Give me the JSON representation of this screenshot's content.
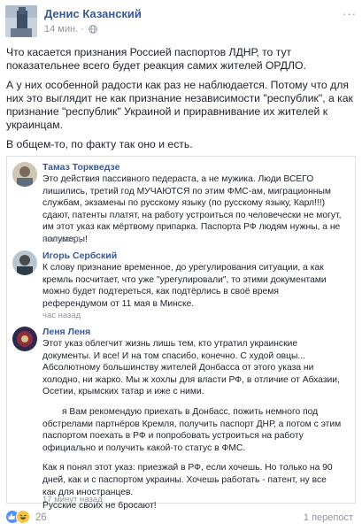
{
  "post": {
    "author": "Денис Казанский",
    "time": "14 мин.",
    "more_label": "···",
    "globe_icon": "globe-icon",
    "paragraphs": [
      "Что касается признания Россией паспортов ЛДНР, то тут показательнее всего будет реакция самих жителей ОРДЛО.",
      "А у них особенной радости как раз не наблюдается. Потому что для них это выглядит не как признание независимости \"республик\", а как признание \"республик\" Украиной и приравнивание их жителей к украинцам.",
      "В общем-то, по факту так оно и есть."
    ]
  },
  "comments": [
    {
      "name": "Тамаз Торкведзе",
      "paragraphs": [
        "Это действия пассивного педераста, а не мужика. Люди ВСЕГО лишились, третий год МУЧАЮТСЯ по этим ФМС-ам, миграционным службам, экзамены по русскому языку (по русскому языку, Карл!!!) сдают, патенты платят, на работу устроиться по человечески не могут, им этот указ как мёртвому припарка. Паспорта РФ людям нужны, а не полумеры!"
      ],
      "time": "час назад"
    },
    {
      "name": "Игорь Сербский",
      "paragraphs": [
        "К слову признание временное, до урегулирования ситуации, а как кремль посчитает, что уже \"урегулировали\", то этими документами можно будет подтереться, как подтёрлись в своё время референдумом от 11 мая в Минске."
      ],
      "time": "час назад"
    },
    {
      "name": "Леня Леня",
      "paragraphs": [
        "Этот указ облегчит жизнь лишь тем, кто утратил украинские документы. И все! И на том спасибо, конечно. С худой овцы... Абсолютному большинству жителей Донбасса от этого указа ни холодно, ни жарко. Мы ж хохлы для власти РФ, в отличие от Абхазии, Осетии, крымских татар и иже с ними.",
        "я Вам рекомендую приехать в Донбасс, пожить немного под обстрелами партнёров Кремля, получить паспорт ДНР, а потом с этим паспортом поехать в РФ и попробовать устроиться на работу официально и получить какой-то статус в ФМС.",
        "Как я понял этот указ: приезжай в РФ, если хочешь. Но только на 90 дней, как и с паспортом украины. Хочешь работать - патент, ну все как для иностранцев.",
        "Русские своих не бросают!"
      ],
      "time": "17 минут назад"
    }
  ],
  "footer": {
    "reaction_count": "26",
    "shares": "1 перепост",
    "reactions": [
      "like",
      "laugh"
    ]
  },
  "colors": {
    "link": "#365899",
    "muted": "#90949c",
    "border": "#dddfe2",
    "like": "#5890ff",
    "laugh": "#f7c644"
  }
}
